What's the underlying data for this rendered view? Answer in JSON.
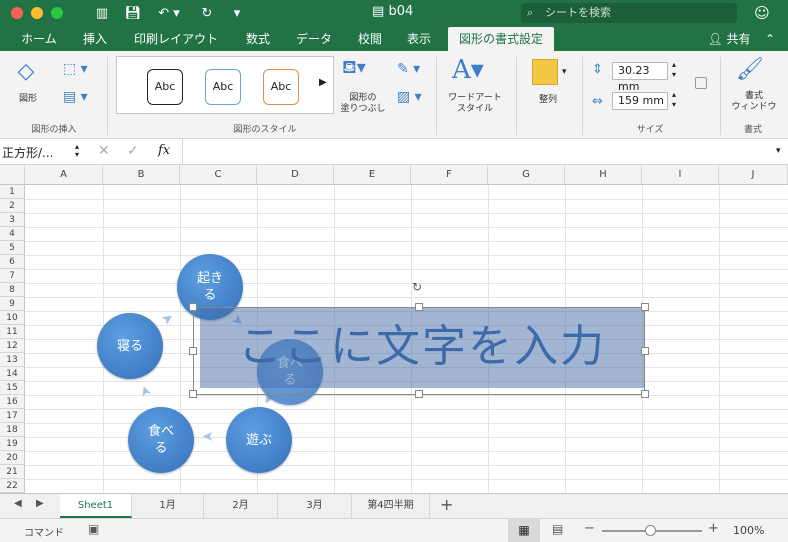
{
  "window": {
    "title": "b04",
    "search_placeholder": "シートを検索"
  },
  "tabs": [
    "ホーム",
    "挿入",
    "印刷レイアウト",
    "数式",
    "データ",
    "校閲",
    "表示",
    "図形の書式設定"
  ],
  "share_label": "共有",
  "ribbon": {
    "shape_label": "図形",
    "group_insert_label": "図形の挿入",
    "styles": [
      "Abc",
      "Abc",
      "Abc"
    ],
    "group_styles_label": "図形のスタイル",
    "fill_label": "図形の\n塗りつぶし",
    "wordart_label": "ワードアート\nスタイル",
    "arrange_label": "整列",
    "height_value": "30.23 mm",
    "width_value": "159 mm",
    "group_size_label": "サイズ",
    "pane_label": "書式\nウィンドウ",
    "group_format_label": "書式"
  },
  "formula_bar": {
    "name_box": "正方形/...",
    "fx": "fx"
  },
  "columns": [
    "A",
    "B",
    "C",
    "D",
    "E",
    "F",
    "G",
    "H",
    "I",
    "J"
  ],
  "rows": [
    "1",
    "2",
    "3",
    "4",
    "5",
    "6",
    "7",
    "8",
    "9",
    "10",
    "11",
    "12",
    "13",
    "14",
    "15",
    "16",
    "17",
    "18",
    "19",
    "20",
    "21",
    "22"
  ],
  "diagram": {
    "nodes": [
      "起き\nる",
      "寝る",
      "食べ\nる",
      "遊ぶ",
      "食べ\nる"
    ],
    "text_shape": "ここに文字を入力"
  },
  "sheets": [
    "Sheet1",
    "1月",
    "2月",
    "3月",
    "第4四半期"
  ],
  "status": {
    "mode": "コマンド",
    "zoom": "100%"
  },
  "colors": {
    "accent": "#217346",
    "shape": "#3f7fc8"
  }
}
